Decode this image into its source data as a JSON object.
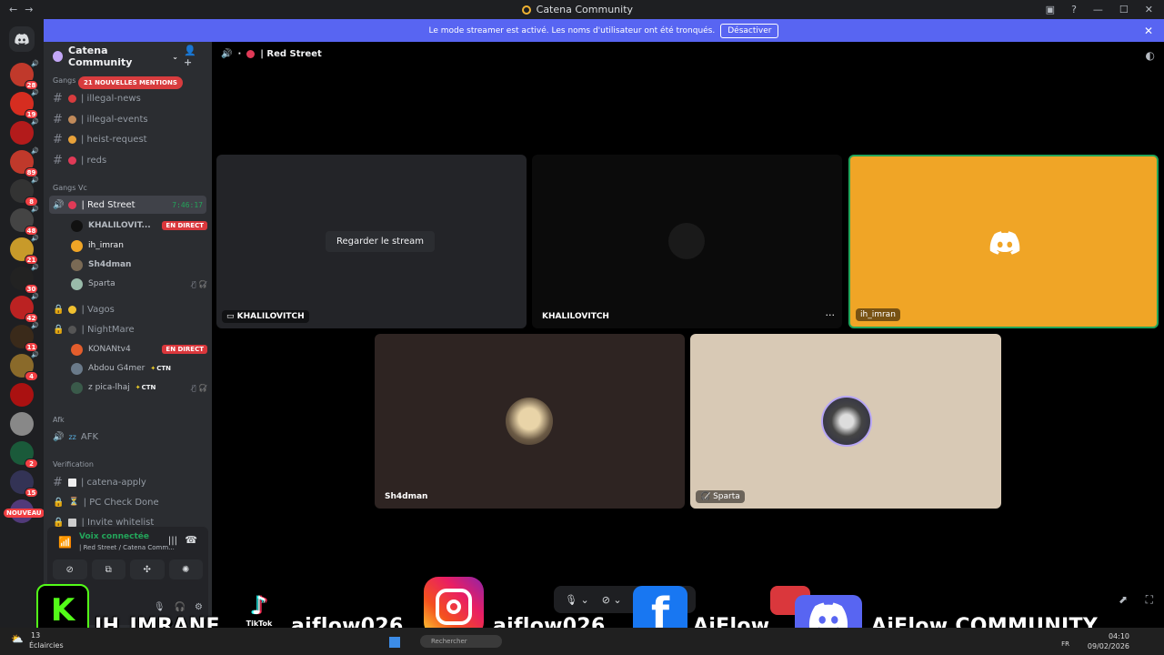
{
  "window": {
    "title": "Catena Community"
  },
  "banner": {
    "text": "Le mode streamer est activé. Les noms d'utilisateur ont été tronqués.",
    "button": "Désactiver"
  },
  "server_badges": [
    "28",
    "19",
    "",
    "89",
    "8",
    "48",
    "21",
    "30",
    "42",
    "11",
    "4",
    "",
    "",
    "2",
    "15",
    ""
  ],
  "server_new_label": "NOUVEAU",
  "guild": {
    "name": "Catena Community"
  },
  "mentions_pill": "21 NOUVELLES MENTIONS",
  "categories": {
    "gangs": "Gangs",
    "gangs_vc": "Gangs Vc",
    "afk": "Afk",
    "verification": "Verification"
  },
  "channels": {
    "illegal_news": "| illegal-news",
    "illegal_events": "| illegal-events",
    "heist_request": "| heist-request",
    "reds": "| reds",
    "red_street": "| Red Street",
    "red_street_timer": "7:46:17",
    "vagos": "| Vagos",
    "nightmare": "| NightMare",
    "afk": "AFK",
    "catena_apply": "| catena-apply",
    "pc_check": "| PC Check Done",
    "invite_whitelist": "| Invite whitelist"
  },
  "members": {
    "khalilovitch": "KHALILOVIT...",
    "live_label": "EN DIRECT",
    "ih_imran": "ih_imran",
    "sh4dman": "Sh4dman",
    "sparta": "Sparta",
    "konan": "KONANtv4",
    "abdou": "Abdou G4mer",
    "zpica": "z pica-lhaj",
    "ctn": "CTN"
  },
  "voice": {
    "status": "Voix connectée",
    "location": "| Red Street / Catena Comm..."
  },
  "call": {
    "header": "| Red Street",
    "watch_stream": "Regarder le stream",
    "tile_khalil_1": "KHALILOVITCH",
    "tile_khalil_2": "KHALILOVITCH",
    "tile_imran": "ih_imran",
    "tile_sh4dman": "Sh4dman",
    "tile_sparta": "Sparta",
    "more": "···"
  },
  "overlay": {
    "kick_name": "IH_IMRANE",
    "tiktok_label": "TikTok",
    "tiktok_name": "aiflow026",
    "instagram_name": "aiflow026",
    "facebook_name": "AiFlow",
    "discord_name": "AiFlow COMMUNITY"
  },
  "taskbar": {
    "weather": "Éclaircies",
    "temp": "13",
    "search": "Rechercher",
    "lang": "FR",
    "time": "04:10",
    "date": "09/02/2026"
  },
  "colors": {
    "accent": "#5865f2",
    "online": "#23a55a",
    "live": "#da373c",
    "imran_tile": "#f0a526",
    "sh4dman_tile": "#2e2422",
    "sparta_tile": "#d8c9b5"
  }
}
